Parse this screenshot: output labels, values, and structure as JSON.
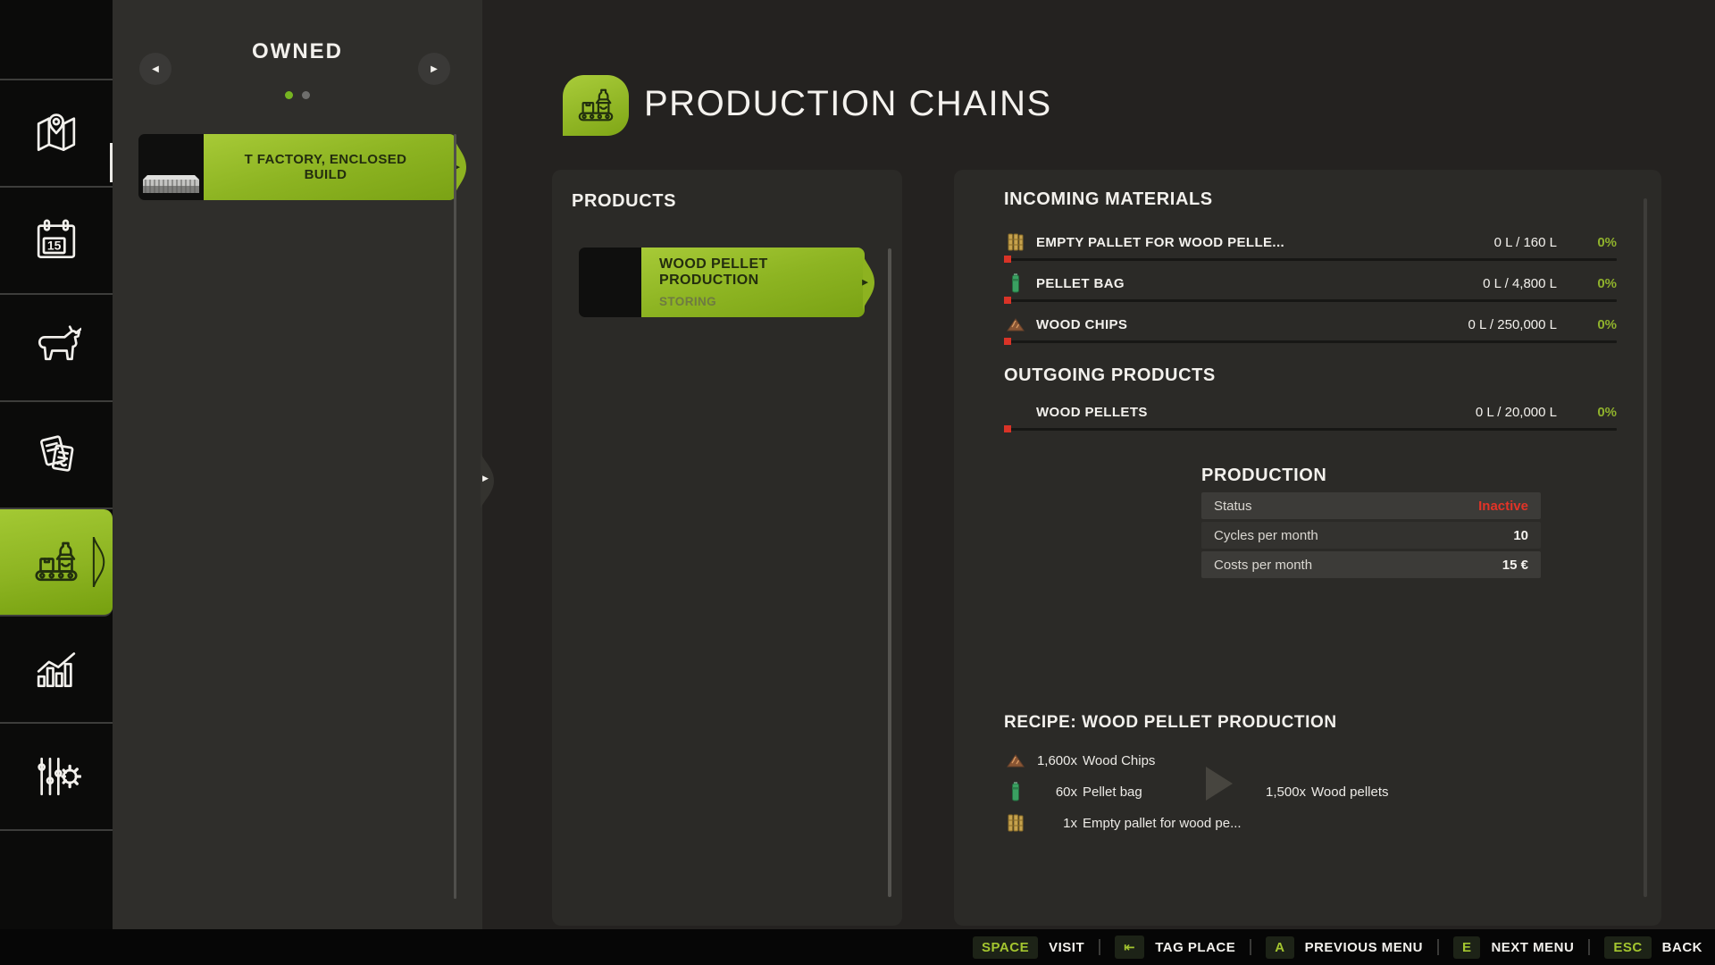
{
  "colors": {
    "accent": "#8fb91e",
    "status_red": "#e23327",
    "percent_green": "#8fb12c"
  },
  "sidebar": {
    "calendar_day": "15",
    "items": [
      {
        "icon": "map-icon"
      },
      {
        "icon": "calendar-icon"
      },
      {
        "icon": "animals-icon"
      },
      {
        "icon": "contracts-icon"
      },
      {
        "icon": "production-chains-icon",
        "active": true
      },
      {
        "icon": "statistics-icon"
      },
      {
        "icon": "settings-icon"
      }
    ]
  },
  "owned_panel": {
    "title": "OWNED",
    "pagination": {
      "current": 1,
      "total": 2
    },
    "items": [
      {
        "label": "T FACTORY, ENCLOSED BUILD"
      }
    ]
  },
  "header": {
    "title": "PRODUCTION CHAINS"
  },
  "products_panel": {
    "title": "PRODUCTS",
    "items": [
      {
        "label": "WOOD PELLET PRODUCTION",
        "status": "STORING"
      }
    ]
  },
  "incoming": {
    "title": "INCOMING MATERIALS",
    "rows": [
      {
        "icon": "pallet-icon",
        "label": "EMPTY PALLET FOR WOOD PELLE...",
        "amount": "0 L / 160 L",
        "percent": "0%"
      },
      {
        "icon": "pellet-bag-icon",
        "label": "PELLET BAG",
        "amount": "0 L / 4,800 L",
        "percent": "0%"
      },
      {
        "icon": "wood-chips-icon",
        "label": "WOOD CHIPS",
        "amount": "0 L / 250,000 L",
        "percent": "0%"
      }
    ]
  },
  "outgoing": {
    "title": "OUTGOING PRODUCTS",
    "rows": [
      {
        "icon": "",
        "label": "WOOD PELLETS",
        "amount": "0 L / 20,000 L",
        "percent": "0%"
      }
    ]
  },
  "production": {
    "title": "PRODUCTION",
    "rows": [
      {
        "label": "Status",
        "value": "Inactive"
      },
      {
        "label": "Cycles per month",
        "value": "10"
      },
      {
        "label": "Costs per month",
        "value": "15 €"
      }
    ]
  },
  "recipe": {
    "title": "RECIPE: WOOD PELLET PRODUCTION",
    "inputs": [
      {
        "icon": "wood-chips-icon",
        "qty": "1,600x",
        "name": "Wood Chips"
      },
      {
        "icon": "pellet-bag-icon",
        "qty": "60x",
        "name": "Pellet bag"
      },
      {
        "icon": "pallet-icon",
        "qty": "1x",
        "name": "Empty pallet for wood pe..."
      }
    ],
    "output": {
      "qty": "1,500x",
      "name": "Wood pellets"
    }
  },
  "bottom_bar": {
    "actions": [
      {
        "key": "SPACE",
        "label": "VISIT"
      },
      {
        "key": "⇤",
        "label": "TAG PLACE"
      },
      {
        "key": "A",
        "label": "PREVIOUS MENU"
      },
      {
        "key": "E",
        "label": "NEXT MENU"
      },
      {
        "key": "ESC",
        "label": "BACK"
      }
    ]
  }
}
